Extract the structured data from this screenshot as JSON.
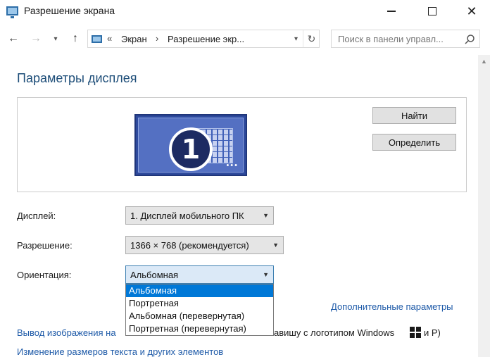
{
  "window": {
    "title": "Разрешение экрана",
    "icon": "display-icon"
  },
  "nav": {
    "address_prefix": "«",
    "breadcrumb_1": "Экран",
    "breadcrumb_sep": "›",
    "breadcrumb_2": "Разрешение экр...",
    "search_placeholder": "Поиск в панели управл..."
  },
  "main": {
    "title": "Параметры дисплея",
    "monitor_number": "1",
    "monitor_dots": "•••",
    "find_button": "Найти",
    "identify_button": "Определить",
    "display_label": "Дисплей:",
    "display_value": "1. Дисплей мобильного ПК",
    "resolution_label": "Разрешение:",
    "resolution_value": "1366 × 768 (рекомендуется)",
    "orientation_label": "Ориентация:",
    "orientation_value": "Альбомная",
    "orientation_options": [
      "Альбомная",
      "Портретная",
      "Альбомная (перевернутая)",
      "Портретная (перевернутая)"
    ],
    "advanced_link": "Дополнительные параметры",
    "project_link": "Вывод изображения на",
    "project_tail": "авишу с логотипом Windows",
    "project_tail2": "и P)",
    "text_size_link": "Изменение размеров текста и других элементов"
  },
  "colors": {
    "accent": "#0078d7",
    "title": "#1e4e79",
    "link": "#1e5aa8",
    "monitor": "#2e4a9e"
  }
}
